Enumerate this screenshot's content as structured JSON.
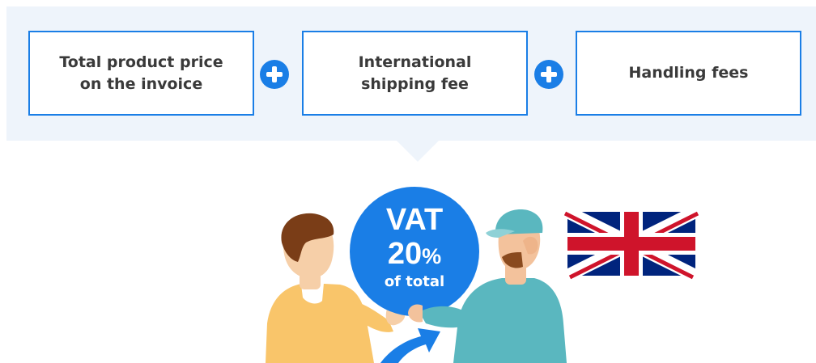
{
  "boxes": [
    {
      "label": "Total product price\non the invoice"
    },
    {
      "label": "International\nshipping fee"
    },
    {
      "label": "Handling fees"
    }
  ],
  "operator_icon": "plus-circle-icon",
  "vat": {
    "title": "VAT",
    "rate": "20",
    "percent_sign": "%",
    "subtitle": "of total"
  },
  "flag_icon": "union-jack-flag-icon",
  "colors": {
    "accent": "#1a7ee6",
    "panel": "#eef4fb",
    "box_text": "#3a3a3a",
    "buyer_shirt": "#f9c56a",
    "courier_shirt": "#5ab7bf",
    "flag_blue": "#00247d",
    "flag_red": "#cf142b"
  }
}
